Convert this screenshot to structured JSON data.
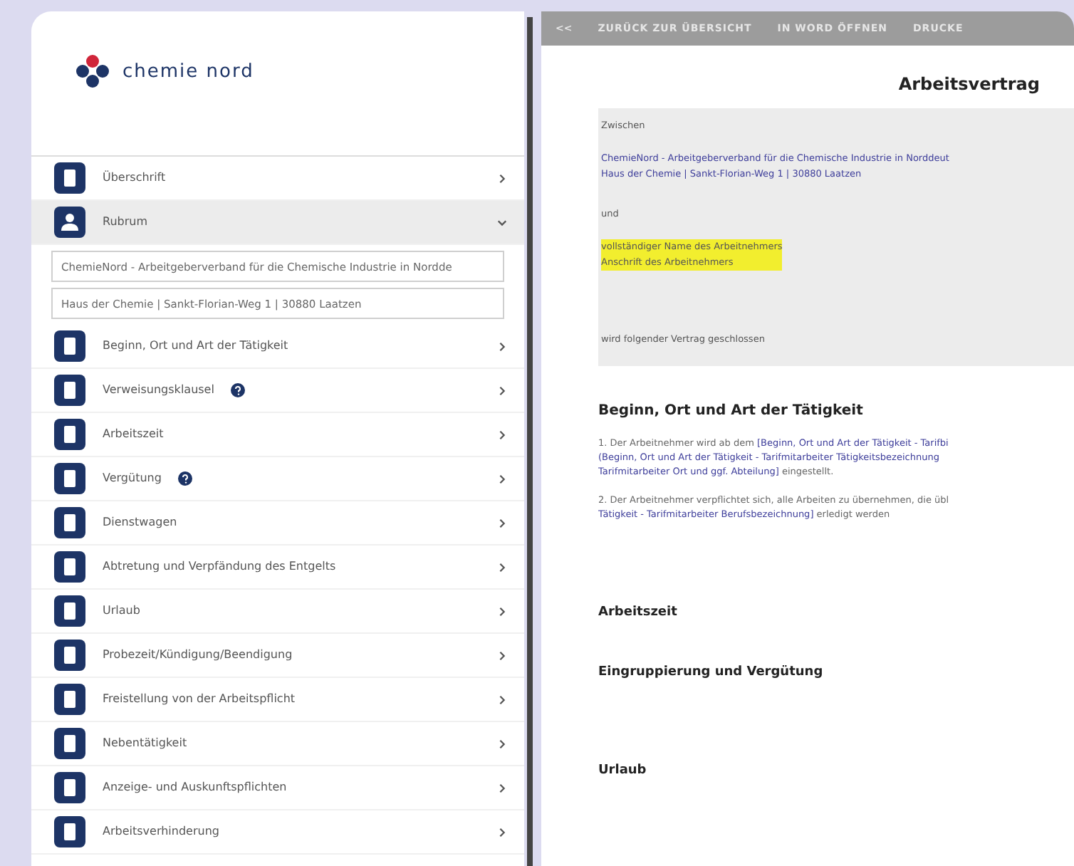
{
  "sidebar": {
    "logo": {
      "name": "chemie nord"
    },
    "sections": [
      {
        "label": "Überschrift",
        "kind": "doc",
        "help": false,
        "expanded": false
      },
      {
        "label": "Rubrum",
        "kind": "person",
        "help": false,
        "expanded": true,
        "fields": [
          {
            "value": "ChemieNord - Arbeitgeberverband für die Chemische Industrie in Nordde"
          },
          {
            "value": "Haus der Chemie | Sankt-Florian-Weg 1 | 30880 Laatzen"
          }
        ]
      },
      {
        "label": "Beginn, Ort und Art der Tätigkeit",
        "kind": "doc",
        "help": false,
        "expanded": false
      },
      {
        "label": "Verweisungsklausel",
        "kind": "doc",
        "help": true,
        "expanded": false
      },
      {
        "label": "Arbeitszeit",
        "kind": "doc",
        "help": false,
        "expanded": false
      },
      {
        "label": "Vergütung",
        "kind": "doc",
        "help": true,
        "expanded": false
      },
      {
        "label": "Dienstwagen",
        "kind": "doc",
        "help": false,
        "expanded": false
      },
      {
        "label": "Abtretung und Verpfändung des Entgelts",
        "kind": "doc",
        "help": false,
        "expanded": false
      },
      {
        "label": "Urlaub",
        "kind": "doc",
        "help": false,
        "expanded": false
      },
      {
        "label": "Probezeit/Kündigung/Beendigung",
        "kind": "doc",
        "help": false,
        "expanded": false
      },
      {
        "label": "Freistellung von der Arbeitspflicht",
        "kind": "doc",
        "help": false,
        "expanded": false
      },
      {
        "label": "Nebentätigkeit",
        "kind": "doc",
        "help": false,
        "expanded": false
      },
      {
        "label": "Anzeige- und Auskunftspflichten",
        "kind": "doc",
        "help": false,
        "expanded": false
      },
      {
        "label": "Arbeitsverhinderung",
        "kind": "doc",
        "help": false,
        "expanded": false
      }
    ]
  },
  "toolbar": {
    "back": "<<",
    "buttons": [
      "ZURÜCK ZUR ÜBERSICHT",
      "IN WORD ÖFFNEN",
      "DRUCKE"
    ]
  },
  "document": {
    "title": "Arbeitsvertrag",
    "parties": [
      {
        "kind": "plain",
        "text": "Zwischen"
      },
      {
        "kind": "field",
        "lines": [
          "ChemieNord - Arbeitgeberverband für die Chemische Industrie in Norddeut",
          "Haus der Chemie | Sankt-Florian-Weg 1 | 30880 Laatzen"
        ]
      },
      {
        "kind": "plain",
        "text": "und"
      },
      {
        "kind": "highlight",
        "lines": [
          "vollständiger Name des Arbeitnehmers",
          "Anschrift des Arbeitnehmers"
        ]
      },
      {
        "kind": "plain",
        "text": "wird folgender Vertrag geschlossen"
      }
    ],
    "sections": [
      {
        "heading": "Beginn, Ort und Art der Tätigkeit",
        "items": [
          {
            "number": "1.",
            "lines": [
              [
                {
                  "kind": "plain",
                  "text": "Der Arbeitnehmer wird ab dem "
                },
                {
                  "kind": "field",
                  "text": "[Beginn, Ort und Art der Tätigkeit - Tarifbi"
                }
              ],
              [
                {
                  "kind": "field",
                  "text": "(Beginn, Ort und Art der Tätigkeit - Tarifmitarbeiter Tätigkeitsbezeichnung"
                }
              ],
              [
                {
                  "kind": "field",
                  "text": "Tarifmitarbeiter Ort und ggf. Abteilung]"
                },
                {
                  "kind": "plain",
                  "text": " eingestellt."
                }
              ]
            ]
          },
          {
            "number": "2.",
            "lines": [
              [
                {
                  "kind": "plain",
                  "text": "Der Arbeitnehmer verpflichtet sich, alle Arbeiten zu übernehmen, die übl"
                }
              ],
              [
                {
                  "kind": "field",
                  "text": "Tätigkeit - Tarifmitarbeiter Berufsbezeichnung]"
                },
                {
                  "kind": "plain",
                  "text": " erledigt werden"
                }
              ]
            ]
          }
        ]
      },
      {
        "heading": "Arbeitszeit"
      },
      {
        "heading": "Eingruppierung und Vergütung"
      },
      {
        "heading": "Urlaub"
      }
    ]
  }
}
